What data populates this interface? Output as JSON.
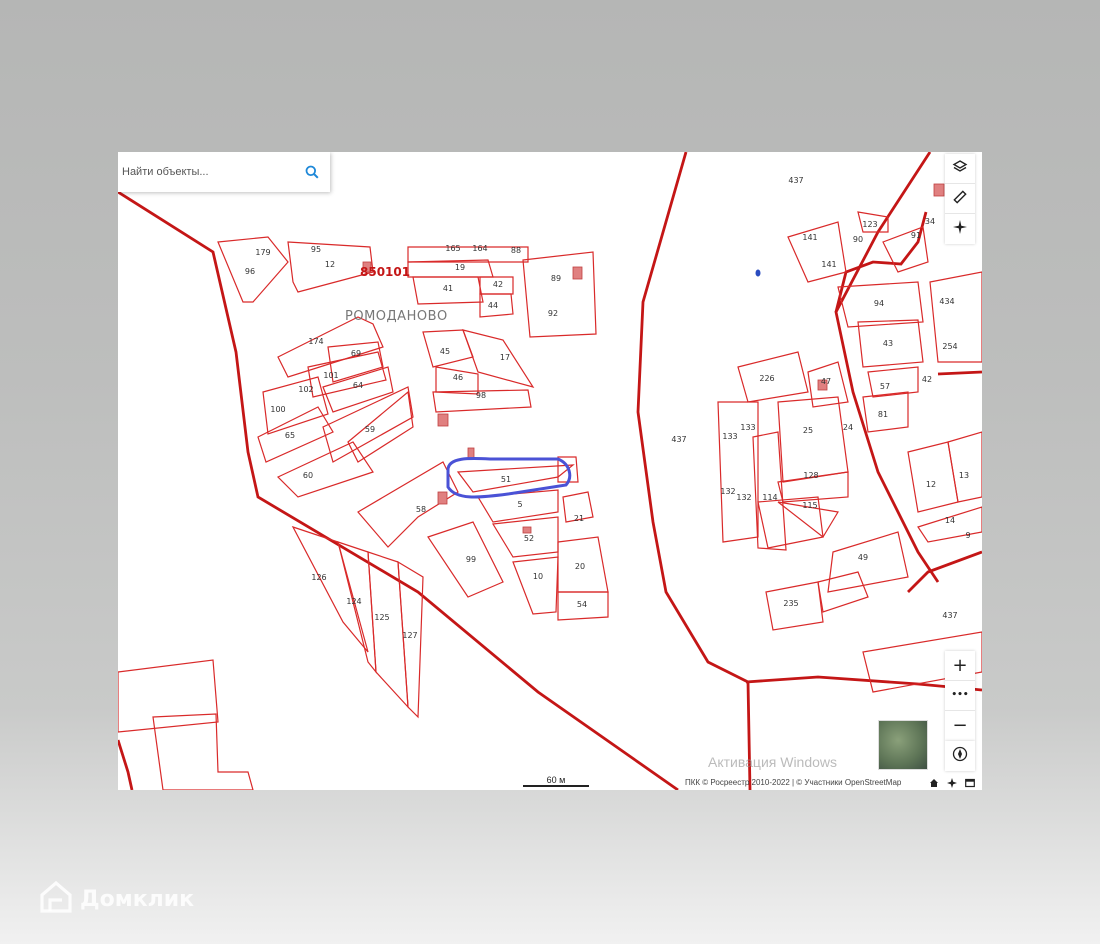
{
  "search": {
    "placeholder": "Найти объекты..."
  },
  "map": {
    "quarter_label": "850101",
    "place_name": "РОМОДАНОВО",
    "parcels": [
      {
        "id": "p179",
        "label": "179"
      },
      {
        "id": "p95",
        "label": "95"
      },
      {
        "id": "p96",
        "label": "96"
      },
      {
        "id": "p12a",
        "label": "12"
      },
      {
        "id": "p165",
        "label": "165"
      },
      {
        "id": "p164",
        "label": "164"
      },
      {
        "id": "p88",
        "label": "88"
      },
      {
        "id": "p19",
        "label": "19"
      },
      {
        "id": "p41",
        "label": "41"
      },
      {
        "id": "p42a",
        "label": "42"
      },
      {
        "id": "p44",
        "label": "44"
      },
      {
        "id": "p89",
        "label": "89"
      },
      {
        "id": "p92",
        "label": "92"
      },
      {
        "id": "p174",
        "label": "174"
      },
      {
        "id": "p69",
        "label": "69"
      },
      {
        "id": "p101",
        "label": "101"
      },
      {
        "id": "p102",
        "label": "102"
      },
      {
        "id": "p64",
        "label": "64"
      },
      {
        "id": "p100",
        "label": "100"
      },
      {
        "id": "p65",
        "label": "65"
      },
      {
        "id": "p59",
        "label": "59"
      },
      {
        "id": "p60",
        "label": "60"
      },
      {
        "id": "p45",
        "label": "45"
      },
      {
        "id": "p17",
        "label": "17"
      },
      {
        "id": "p46",
        "label": "46"
      },
      {
        "id": "p98",
        "label": "98"
      },
      {
        "id": "p51",
        "label": "51"
      },
      {
        "id": "p58",
        "label": "58"
      },
      {
        "id": "p5",
        "label": "5"
      },
      {
        "id": "p21",
        "label": "21"
      },
      {
        "id": "p52",
        "label": "52"
      },
      {
        "id": "p99",
        "label": "99"
      },
      {
        "id": "p10",
        "label": "10"
      },
      {
        "id": "p20",
        "label": "20"
      },
      {
        "id": "p54",
        "label": "54"
      },
      {
        "id": "p126",
        "label": "126"
      },
      {
        "id": "p124",
        "label": "124"
      },
      {
        "id": "p125",
        "label": "125"
      },
      {
        "id": "p127",
        "label": "127"
      },
      {
        "id": "p437a",
        "label": "437"
      },
      {
        "id": "p437b",
        "label": "437"
      },
      {
        "id": "p437c",
        "label": "437"
      },
      {
        "id": "p141a",
        "label": "141"
      },
      {
        "id": "p141b",
        "label": "141"
      },
      {
        "id": "p123",
        "label": "123"
      },
      {
        "id": "p90",
        "label": "90"
      },
      {
        "id": "p91",
        "label": "91"
      },
      {
        "id": "p34",
        "label": "34"
      },
      {
        "id": "p94",
        "label": "94"
      },
      {
        "id": "p434",
        "label": "434"
      },
      {
        "id": "p43",
        "label": "43"
      },
      {
        "id": "p254",
        "label": "254"
      },
      {
        "id": "p226",
        "label": "226"
      },
      {
        "id": "p47",
        "label": "47"
      },
      {
        "id": "p57",
        "label": "57"
      },
      {
        "id": "p42b",
        "label": "42"
      },
      {
        "id": "p81",
        "label": "81"
      },
      {
        "id": "p133a",
        "label": "133"
      },
      {
        "id": "p133b",
        "label": "133"
      },
      {
        "id": "p25",
        "label": "25"
      },
      {
        "id": "p24",
        "label": "24"
      },
      {
        "id": "p128",
        "label": "128"
      },
      {
        "id": "p132a",
        "label": "132"
      },
      {
        "id": "p132b",
        "label": "132"
      },
      {
        "id": "p114",
        "label": "114"
      },
      {
        "id": "p115",
        "label": "115"
      },
      {
        "id": "p12b",
        "label": "12"
      },
      {
        "id": "p13",
        "label": "13"
      },
      {
        "id": "p14",
        "label": "14"
      },
      {
        "id": "p9",
        "label": "9"
      },
      {
        "id": "p49",
        "label": "49"
      },
      {
        "id": "p235",
        "label": "235"
      }
    ]
  },
  "scale": {
    "label": "60 м"
  },
  "watermark": "Активация Windows",
  "attribution": "ПКК © Росреестр 2010-2022 | © Участники OpenStreetMap",
  "controls": {
    "layers_icon": "layers-icon",
    "ruler_icon": "ruler-icon",
    "locate_icon": "crosshair-icon",
    "zoom_in": "+",
    "zoom_more": "•••",
    "zoom_out": "−"
  },
  "brand": {
    "name": "Домклик"
  },
  "colors": {
    "parcel": "#d92a2a",
    "boundary": "#c41616",
    "highlight": "#4a52d6"
  }
}
